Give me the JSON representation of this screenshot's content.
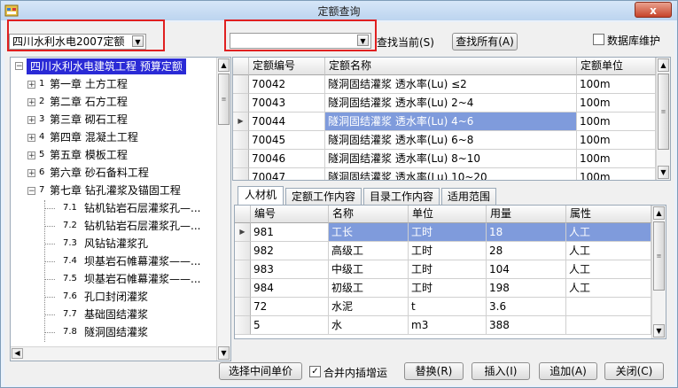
{
  "window": {
    "title": "定额查询",
    "close_label": "x"
  },
  "toolbar": {
    "library_select": "四川水利水电2007定额",
    "search_input_value": "",
    "find_current_label": "查找当前(S)",
    "find_all_label": "查找所有(A)",
    "db_maintain_label": "数据库维护",
    "db_maintain_checked": false
  },
  "tree": {
    "root": "四川水利水电建筑工程 预算定额",
    "chapters": [
      {
        "num": "1",
        "label": "第一章 土方工程"
      },
      {
        "num": "2",
        "label": "第二章 石方工程"
      },
      {
        "num": "3",
        "label": "第三章 砌石工程"
      },
      {
        "num": "4",
        "label": "第四章 混凝土工程"
      },
      {
        "num": "5",
        "label": "第五章 模板工程"
      },
      {
        "num": "6",
        "label": "第六章 砂石备料工程"
      },
      {
        "num": "7",
        "label": "第七章 钻孔灌浆及锚固工程"
      }
    ],
    "sections": [
      {
        "num": "7.1",
        "label": "钻机钻岩石层灌浆孔—..."
      },
      {
        "num": "7.2",
        "label": "钻机钻岩石层灌浆孔—..."
      },
      {
        "num": "7.3",
        "label": "风钻钻灌浆孔"
      },
      {
        "num": "7.4",
        "label": "坝基岩石帷幕灌浆——..."
      },
      {
        "num": "7.5",
        "label": "坝基岩石帷幕灌浆——..."
      },
      {
        "num": "7.6",
        "label": "孔口封闭灌浆"
      },
      {
        "num": "7.7",
        "label": "基础固结灌浆"
      },
      {
        "num": "7.8",
        "label": "隧洞固结灌浆"
      }
    ]
  },
  "quota_table": {
    "headers": [
      "定额编号",
      "定额名称",
      "定额单位"
    ],
    "rows": [
      {
        "code": "70042",
        "name": "隧洞固结灌浆 透水率(Lu) ≤2",
        "unit": "100m"
      },
      {
        "code": "70043",
        "name": "隧洞固结灌浆 透水率(Lu) 2~4",
        "unit": "100m"
      },
      {
        "code": "70044",
        "name": "隧洞固结灌浆 透水率(Lu) 4~6",
        "unit": "100m"
      },
      {
        "code": "70045",
        "name": "隧洞固结灌浆 透水率(Lu) 6~8",
        "unit": "100m"
      },
      {
        "code": "70046",
        "name": "隧洞固结灌浆 透水率(Lu) 8~10",
        "unit": "100m"
      },
      {
        "code": "70047",
        "name": "隧洞固结灌浆 透水率(Lu) 10~20",
        "unit": "100m"
      }
    ],
    "selected_index": 2
  },
  "tabs": [
    "人材机",
    "定额工作内容",
    "目录工作内容",
    "适用范围"
  ],
  "active_tab": 0,
  "resource_table": {
    "headers": [
      "编号",
      "名称",
      "单位",
      "用量",
      "属性"
    ],
    "rows": [
      {
        "code": "981",
        "name": "工长",
        "unit": "工时",
        "qty": "18",
        "attr": "人工"
      },
      {
        "code": "982",
        "name": "高级工",
        "unit": "工时",
        "qty": "28",
        "attr": "人工"
      },
      {
        "code": "983",
        "name": "中级工",
        "unit": "工时",
        "qty": "104",
        "attr": "人工"
      },
      {
        "code": "984",
        "name": "初级工",
        "unit": "工时",
        "qty": "198",
        "attr": "人工"
      },
      {
        "code": "72",
        "name": "水泥",
        "unit": "t",
        "qty": "3.6",
        "attr": ""
      },
      {
        "code": "5",
        "name": "水",
        "unit": "m3",
        "qty": "388",
        "attr": ""
      }
    ],
    "selected_index": 0
  },
  "footer": {
    "select_mid_price_label": "选择中间单价",
    "merge_interp_label": "合并内插增运",
    "merge_interp_checked": true,
    "replace_label": "替换(R)",
    "insert_label": "插入(I)",
    "append_label": "追加(A)",
    "close_label": "关闭(C)"
  },
  "colors": {
    "selection": "#7f9bdc",
    "tree_root_bg": "#2a2ad6",
    "highlight_box": "#e02020"
  }
}
